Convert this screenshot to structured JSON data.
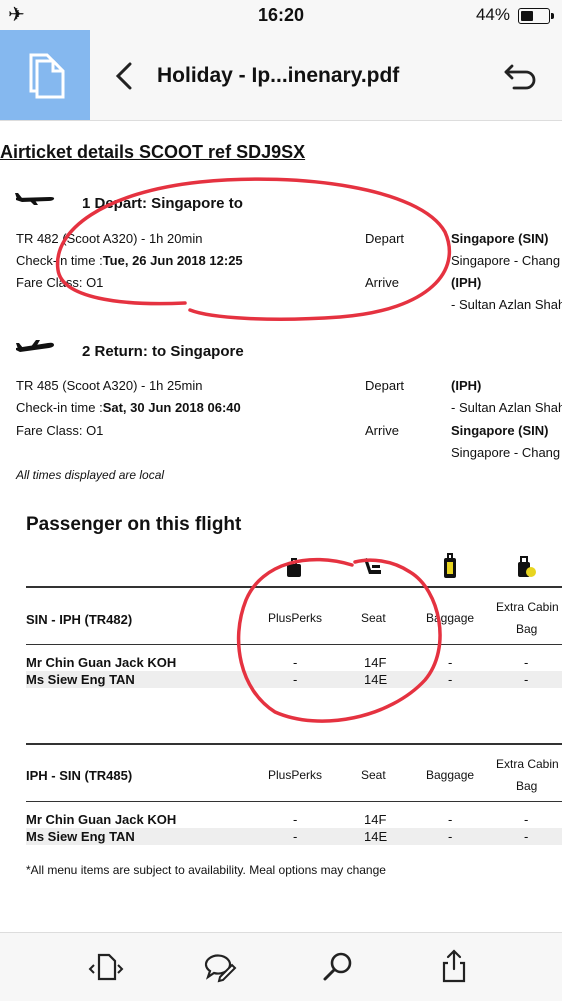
{
  "status_bar": {
    "time": "16:20",
    "battery": "44%"
  },
  "navbar": {
    "title": "Holiday - Ip...inenary.pdf"
  },
  "document": {
    "heading": "Airticket details  SCOOT ref SDJ9SX",
    "depart": {
      "title": "1 Depart: Singapore to",
      "flight": "TR 482 (Scoot A320) - 1h 20min",
      "checkin_label": "Check-in time :",
      "checkin_value": "Tue, 26 Jun 2018 12:25",
      "fare": "Fare Class: O1",
      "depart_label": "Depart",
      "arrive_label": "Arrive",
      "from_code": "Singapore (SIN)",
      "from_name": "Singapore - Chang",
      "to_code": "(IPH)",
      "to_name": "- Sultan Azlan Shah"
    },
    "return": {
      "title": "2 Return: to Singapore",
      "flight": "TR 485 (Scoot A320) - 1h 25min",
      "checkin_label": "Check-in time :",
      "checkin_value": "Sat, 30 Jun 2018 06:40",
      "fare": "Fare Class: O1",
      "depart_label": "Depart",
      "arrive_label": "Arrive",
      "from_code": "(IPH)",
      "from_name": "- Sultan Azlan Shah",
      "to_code": "Singapore (SIN)",
      "to_name": "Singapore - Chang"
    },
    "local_note": "All times displayed are local",
    "passenger_title": "Passenger on this flight",
    "tables": [
      {
        "route": "SIN - IPH (TR482)",
        "cols": [
          "PlusPerks",
          "Seat",
          "Baggage",
          "Extra Cabin",
          "Bag"
        ],
        "rows": [
          {
            "name": "Mr Chin Guan Jack KOH",
            "plusperks": "-",
            "seat": "14F",
            "baggage": "-",
            "extra": "-"
          },
          {
            "name": "Ms Siew Eng TAN",
            "plusperks": "-",
            "seat": "14E",
            "baggage": "-",
            "extra": "-"
          }
        ]
      },
      {
        "route": "IPH - SIN (TR485)",
        "cols": [
          "PlusPerks",
          "Seat",
          "Baggage",
          "Extra Cabin",
          "Bag"
        ],
        "rows": [
          {
            "name": "Mr Chin Guan Jack KOH",
            "plusperks": "-",
            "seat": "14F",
            "baggage": "-",
            "extra": "-"
          },
          {
            "name": "Ms Siew Eng TAN",
            "plusperks": "-",
            "seat": "14E",
            "baggage": "-",
            "extra": "-"
          }
        ]
      }
    ],
    "footnote": "*All menu items are subject to availability. Meal options may change"
  },
  "icons": {
    "document": "document-icon",
    "back": "chevron-left-icon",
    "undo": "undo-icon",
    "pages": "pages-icon",
    "comment": "comment-edit-icon",
    "search": "search-icon",
    "share": "share-icon"
  },
  "colors": {
    "accent": "#85b8ef",
    "annotation": "#e53240"
  }
}
